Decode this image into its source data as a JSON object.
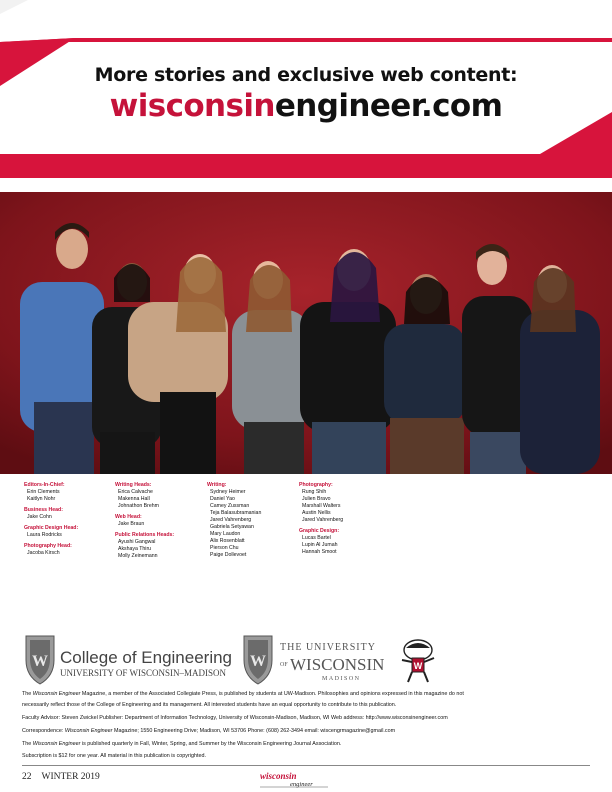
{
  "banner": {
    "title": "More stories and exclusive web content:",
    "url_part1": "wisconsin",
    "url_part2": "engineer.com"
  },
  "staff": {
    "col1": [
      {
        "head": "Editors-In-Chief:",
        "names": [
          "Erin Clements",
          "Kaitlyn Nohr"
        ]
      },
      {
        "head": "Business Head:",
        "names": [
          "Jake Cohn"
        ]
      },
      {
        "head": "Graphic Design Head:",
        "names": [
          "Laura Rodricks"
        ]
      },
      {
        "head": "Photography Head:",
        "names": [
          "Jacoba Kirsch"
        ]
      }
    ],
    "col2": [
      {
        "head": "Writing Heads:",
        "names": [
          "Erica Calvache",
          "Makenna Hall",
          "Johnathon Brehm"
        ]
      },
      {
        "head": "Web Head:",
        "names": [
          "Jake Braun"
        ]
      },
      {
        "head": "Public Relations Heads:",
        "names": [
          "Ayushi Gangwal",
          "Akshaya Thiru",
          "Molly Zeinemann"
        ]
      }
    ],
    "col3": [
      {
        "head": "Writing:",
        "names": [
          "Sydney Heimer",
          "Daniel Yao",
          "Camey Zussman",
          "Teja Balasubramanian",
          "Jared Vahrenberg",
          "Gabriela Setyawan",
          "Mary Laudon",
          "Alix Rosenblatt",
          "Pierson Chu",
          "Paige Dollevoet"
        ]
      }
    ],
    "col4": [
      {
        "head": "Photography:",
        "names": [
          "Rung Shih",
          "Julien Bravo",
          "Marshall Walters",
          "Austin Nellis",
          "Jared Vahrenberg"
        ]
      },
      {
        "head": "Graphic Design:",
        "names": [
          "Lucas Bartel",
          "Lupin Al Jumah",
          "Hannah Smoot"
        ]
      }
    ]
  },
  "logos": {
    "coe_line1": "College of Engineering",
    "coe_line2": "UNIVERSITY OF WISCONSIN–MADISON",
    "uw_line1": "THE UNIVERSITY",
    "uw_line2": "WISCONSIN",
    "uw_line3": "MADISON",
    "uw_of": "OF"
  },
  "footer": {
    "p1a_pre": "The ",
    "p1a_it": "Wisconsin Engineer",
    "p1a_post": " Magazine, a member of the Associated Collegiate Press, is published by students at UW-Madison. Philosophies and opinions expressed in this magazine do not",
    "p1b": "necessarily reflect those of the College of Engineering and its management. All interested students have an equal opportunity to contribute to this publication.",
    "p2": "Faculty Advisor: Steven Zwickel Publisher: Department of Information Technology, University of Wisconsin-Madison, Madison, WI Web address: http://www.wisconsinengineer.com",
    "p3_pre": "Correspondence: ",
    "p3_it": "Wisconsin Engineer",
    "p3_post": " Magazine; 1550 Engineering Drive; Madison, WI 53706 Phone: (608) 262-3494 email: wiscengrmagazine@gmail.com",
    "p4_pre": "The ",
    "p4_it": "Wisconsin Engineer",
    "p4_post": " is published quarterly in Fall, Winter, Spring, and Summer by the Wisconsin Engineering Journal Association.",
    "p5": "Subscription is $12 for one year. All material in this publication is copyrighted."
  },
  "folio": {
    "page": "22",
    "issue": "WINTER 2019",
    "mark_top": "wisconsin",
    "mark_bottom": "engineer"
  },
  "colors": {
    "accent_red": "#c5123a",
    "photo_bg": "#8e1820"
  }
}
